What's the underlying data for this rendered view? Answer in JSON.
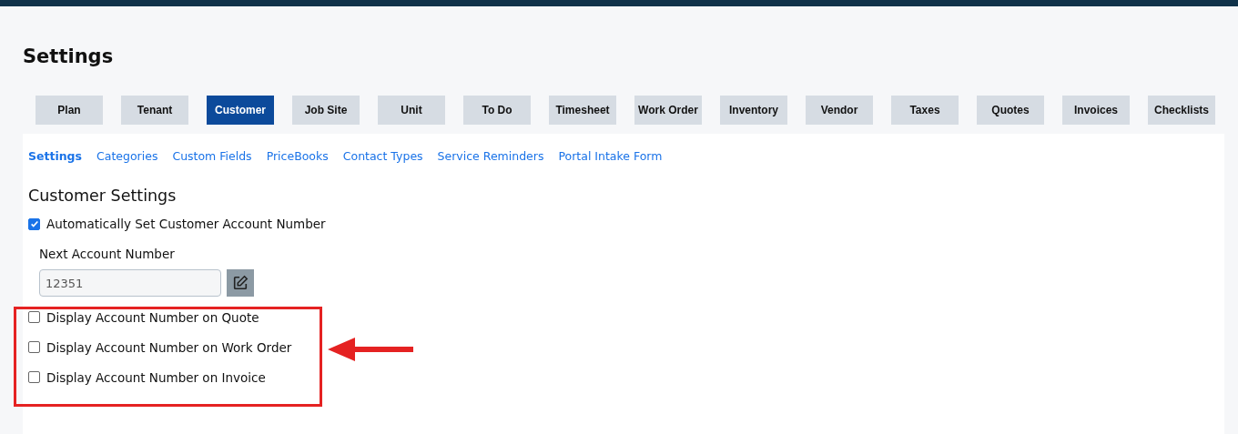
{
  "page_title": "Settings",
  "tabs": [
    {
      "label": "Plan",
      "selected": false
    },
    {
      "label": "Tenant",
      "selected": false
    },
    {
      "label": "Customer",
      "selected": true
    },
    {
      "label": "Job Site",
      "selected": false
    },
    {
      "label": "Unit",
      "selected": false
    },
    {
      "label": "To Do",
      "selected": false
    },
    {
      "label": "Timesheet",
      "selected": false
    },
    {
      "label": "Work Order",
      "selected": false
    },
    {
      "label": "Inventory",
      "selected": false
    },
    {
      "label": "Vendor",
      "selected": false
    },
    {
      "label": "Taxes",
      "selected": false
    },
    {
      "label": "Quotes",
      "selected": false
    },
    {
      "label": "Invoices",
      "selected": false
    },
    {
      "label": "Checklists",
      "selected": false
    }
  ],
  "sub_tabs": [
    {
      "label": "Settings",
      "selected": true
    },
    {
      "label": "Categories",
      "selected": false
    },
    {
      "label": "Custom Fields",
      "selected": false
    },
    {
      "label": "PriceBooks",
      "selected": false
    },
    {
      "label": "Contact Types",
      "selected": false
    },
    {
      "label": "Service Reminders",
      "selected": false
    },
    {
      "label": "Portal Intake Form",
      "selected": false
    }
  ],
  "section_title": "Customer Settings",
  "auto_number": {
    "label": "Automatically Set Customer Account Number",
    "checked": true
  },
  "next_number": {
    "label": "Next Account Number",
    "value": "12351"
  },
  "display_options": [
    {
      "label": "Display Account Number on Quote",
      "checked": false
    },
    {
      "label": "Display Account Number on Work Order",
      "checked": false
    },
    {
      "label": "Display Account Number on Invoice",
      "checked": false
    }
  ]
}
